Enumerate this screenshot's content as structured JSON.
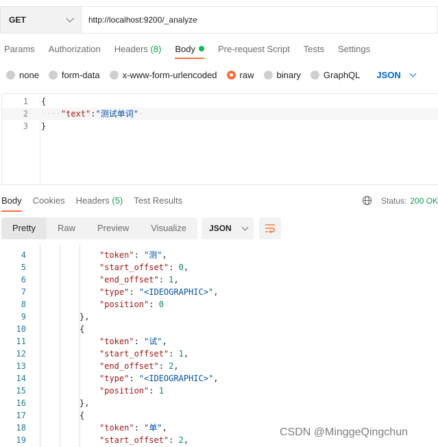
{
  "request": {
    "method": "GET",
    "url": "http://localhost:9200/_analyze"
  },
  "request_tabs": [
    {
      "label": "Params"
    },
    {
      "label": "Authorization"
    },
    {
      "label": "Headers",
      "count": "(8)"
    },
    {
      "label": "Body",
      "active": true
    },
    {
      "label": "Pre-request Script"
    },
    {
      "label": "Tests"
    },
    {
      "label": "Settings"
    }
  ],
  "body_types": [
    {
      "label": "none"
    },
    {
      "label": "form-data"
    },
    {
      "label": "x-www-form-urlencoded"
    },
    {
      "label": "raw",
      "selected": true
    },
    {
      "label": "binary"
    },
    {
      "label": "GraphQL"
    }
  ],
  "body_format": "JSON",
  "request_body": [
    {
      "num": "1",
      "text": "{"
    },
    {
      "num": "2",
      "ws": "····",
      "key": "\"text\"",
      "sep": ":",
      "value": "\"测试单词\"",
      "trail": "·"
    },
    {
      "num": "3",
      "text": "}"
    }
  ],
  "response_tabs": [
    {
      "label": "Body",
      "active": true
    },
    {
      "label": "Cookies"
    },
    {
      "label": "Headers",
      "count": "(5)"
    },
    {
      "label": "Test Results"
    }
  ],
  "status": {
    "label": "Status:",
    "code": "200 OK"
  },
  "views": [
    {
      "label": "Pretty",
      "active": true
    },
    {
      "label": "Raw"
    },
    {
      "label": "Preview"
    },
    {
      "label": "Visualize"
    }
  ],
  "response_format": "JSON",
  "response_lines": [
    {
      "num": "4",
      "kind": "kv",
      "key": "\"token\"",
      "value": "\"测\"",
      "vtype": "str",
      "comma": ","
    },
    {
      "num": "5",
      "kind": "kv",
      "key": "\"start_offset\"",
      "value": "0",
      "vtype": "num",
      "comma": ","
    },
    {
      "num": "6",
      "kind": "kv",
      "key": "\"end_offset\"",
      "value": "1",
      "vtype": "num",
      "comma": ","
    },
    {
      "num": "7",
      "kind": "kv",
      "key": "\"type\"",
      "value": "\"<IDEOGRAPHIC>\"",
      "vtype": "str",
      "comma": ","
    },
    {
      "num": "8",
      "kind": "kv",
      "key": "\"position\"",
      "value": "0",
      "vtype": "num",
      "comma": ""
    },
    {
      "num": "9",
      "kind": "brace",
      "text": "},"
    },
    {
      "num": "10",
      "kind": "brace",
      "text": "{"
    },
    {
      "num": "11",
      "kind": "kv",
      "key": "\"token\"",
      "value": "\"试\"",
      "vtype": "str",
      "comma": ","
    },
    {
      "num": "12",
      "kind": "kv",
      "key": "\"start_offset\"",
      "value": "1",
      "vtype": "num",
      "comma": ","
    },
    {
      "num": "13",
      "kind": "kv",
      "key": "\"end_offset\"",
      "value": "2",
      "vtype": "num",
      "comma": ","
    },
    {
      "num": "14",
      "kind": "kv",
      "key": "\"type\"",
      "value": "\"<IDEOGRAPHIC>\"",
      "vtype": "str",
      "comma": ","
    },
    {
      "num": "15",
      "kind": "kv",
      "key": "\"position\"",
      "value": "1",
      "vtype": "num",
      "comma": ""
    },
    {
      "num": "16",
      "kind": "brace",
      "text": "},"
    },
    {
      "num": "17",
      "kind": "brace",
      "text": "{"
    },
    {
      "num": "18",
      "kind": "kv",
      "key": "\"token\"",
      "value": "\"单\"",
      "vtype": "str",
      "comma": ","
    },
    {
      "num": "19",
      "kind": "kv",
      "key": "\"start_offset\"",
      "value": "2",
      "vtype": "num",
      "comma": ","
    }
  ],
  "watermark": "CSDN @MinggeQingchun"
}
